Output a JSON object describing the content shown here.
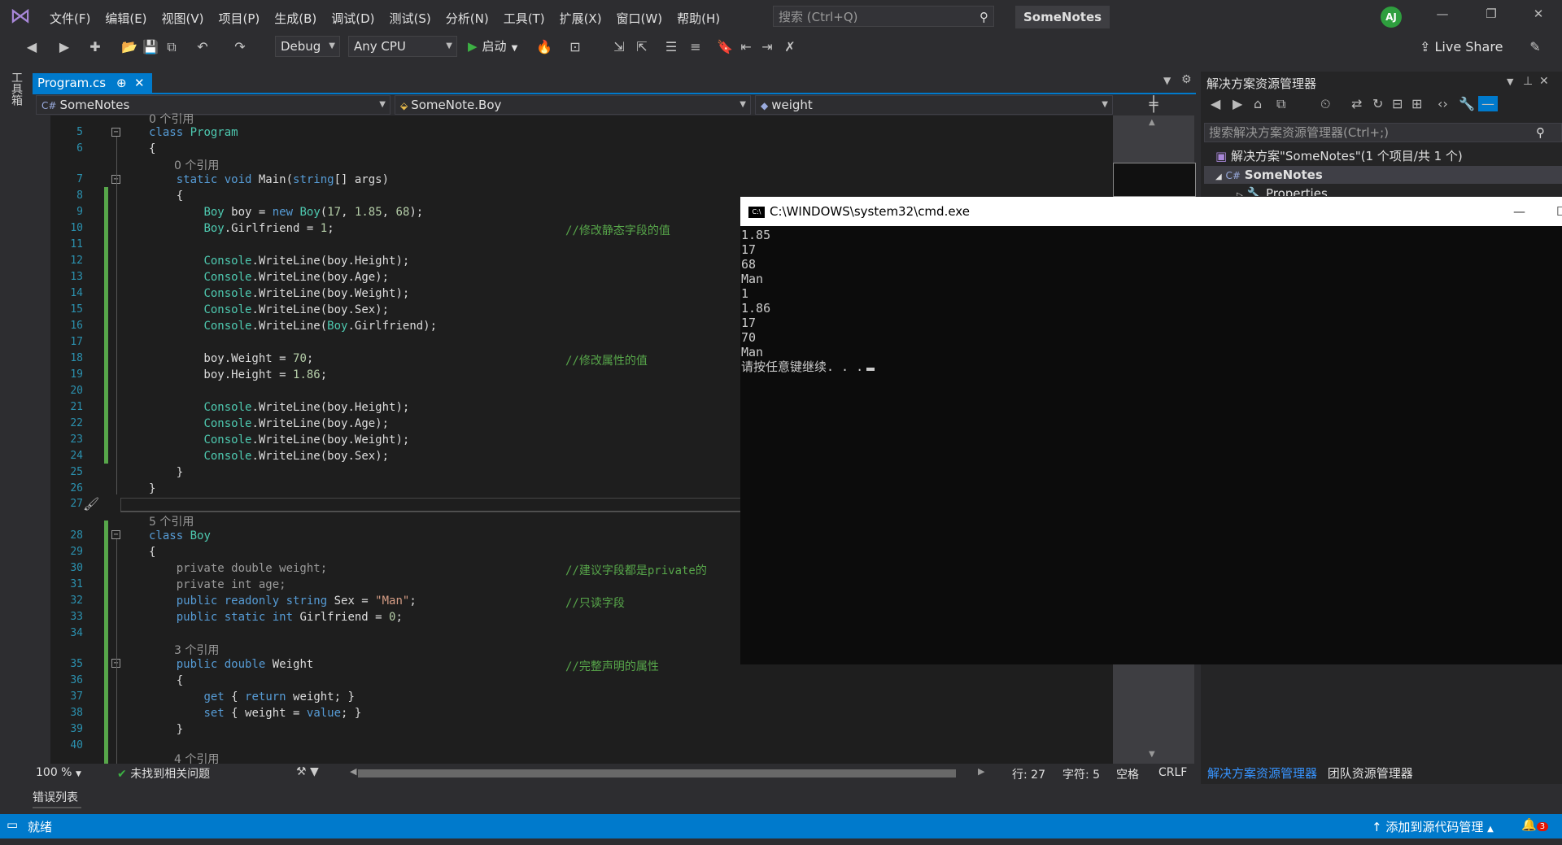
{
  "app": {
    "menu": [
      "文件(F)",
      "编辑(E)",
      "视图(V)",
      "项目(P)",
      "生成(B)",
      "调试(D)",
      "测试(S)",
      "分析(N)",
      "工具(T)",
      "扩展(X)",
      "窗口(W)",
      "帮助(H)"
    ],
    "search_placeholder": "搜索 (Ctrl+Q)",
    "project_title": "SomeNotes",
    "avatar_initials": "AJ",
    "accent_color": "#007acc"
  },
  "toolbar": {
    "config": "Debug",
    "platform": "Any CPU",
    "start_label": "启动",
    "live_share": "Live Share"
  },
  "toolbox": {
    "label": "工具箱"
  },
  "document": {
    "tab_label": "Program.cs",
    "nav_project": "SomeNotes",
    "nav_class": "SomeNote.Boy",
    "nav_member": "weight"
  },
  "editor": {
    "line_numbers": [
      "5",
      "6",
      "7",
      "8",
      "9",
      "10",
      "11",
      "12",
      "13",
      "14",
      "15",
      "16",
      "17",
      "18",
      "19",
      "20",
      "21",
      "22",
      "23",
      "24",
      "25",
      "26",
      "27",
      "28",
      "29",
      "30",
      "31",
      "32",
      "33",
      "34",
      "35",
      "36",
      "37",
      "38",
      "39",
      "40"
    ],
    "codelens": {
      "program_refs": "0 个引用",
      "main_refs": "0 个引用",
      "boy_refs": "5 个引用",
      "weight_refs": "3 个引用",
      "next_refs": "4 个引用"
    },
    "comments": {
      "c10": "//修改静态字段的值",
      "c18": "//修改属性的值",
      "c30": "//建议字段都是private的",
      "c32": "//只读字段",
      "c35": "//完整声明的属性"
    },
    "zoom": "100 %",
    "issues": "未找到相关问题",
    "row": "行: 27",
    "col": "字符: 5",
    "whitespace": "空格",
    "eol": "CRLF"
  },
  "solution_explorer": {
    "title": "解决方案资源管理器",
    "search_placeholder": "搜索解决方案资源管理器(Ctrl+;)",
    "solution_label": "解决方案\"SomeNotes\"(1 个项目/共 1 个)",
    "project_label": "SomeNotes",
    "properties_label": "Properties",
    "tab_active": "解决方案资源管理器",
    "tab_other": "团队资源管理器"
  },
  "cmd": {
    "title": "C:\\WINDOWS\\system32\\cmd.exe",
    "output": [
      "1.85",
      "17",
      "68",
      "Man",
      "1",
      "1.86",
      "17",
      "70",
      "Man"
    ],
    "prompt": "请按任意键继续. . ."
  },
  "bottom_panel": {
    "error_list": "错误列表"
  },
  "statusbar": {
    "ready": "就绪",
    "source_control": "添加到源代码管理",
    "notifications": "3"
  }
}
